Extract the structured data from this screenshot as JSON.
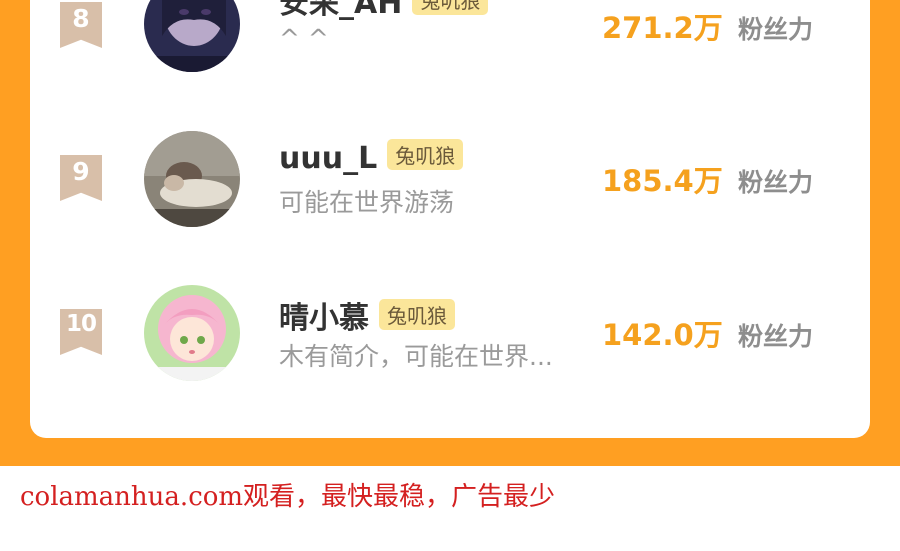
{
  "leaderboard": {
    "fans_unit_label": "粉丝力",
    "rows": [
      {
        "rank": "8",
        "name": "安采_AH",
        "badge": "兔叽狼",
        "bio": "^ ^",
        "fans": "271.2万",
        "avatar_icon": "dark-portrait-avatar"
      },
      {
        "rank": "9",
        "name": "uuu_L",
        "badge": "兔叽狼",
        "bio": "可能在世界游荡",
        "fans": "185.4万",
        "avatar_icon": "sleeping-person-avatar"
      },
      {
        "rank": "10",
        "name": "晴小慕",
        "badge": "兔叽狼",
        "bio": "木有简介，可能在世界...",
        "fans": "142.0万",
        "avatar_icon": "pink-hair-girl-avatar"
      }
    ]
  },
  "watermark": {
    "text": "colamanhua.com观看，最快最稳，广告最少"
  },
  "colors": {
    "accent_orange": "#ff9f22",
    "fans_orange": "#f5a11e",
    "badge_yellow": "#fbe69a",
    "rank_tan": "#d8bfa9",
    "watermark_red": "#d42020"
  }
}
